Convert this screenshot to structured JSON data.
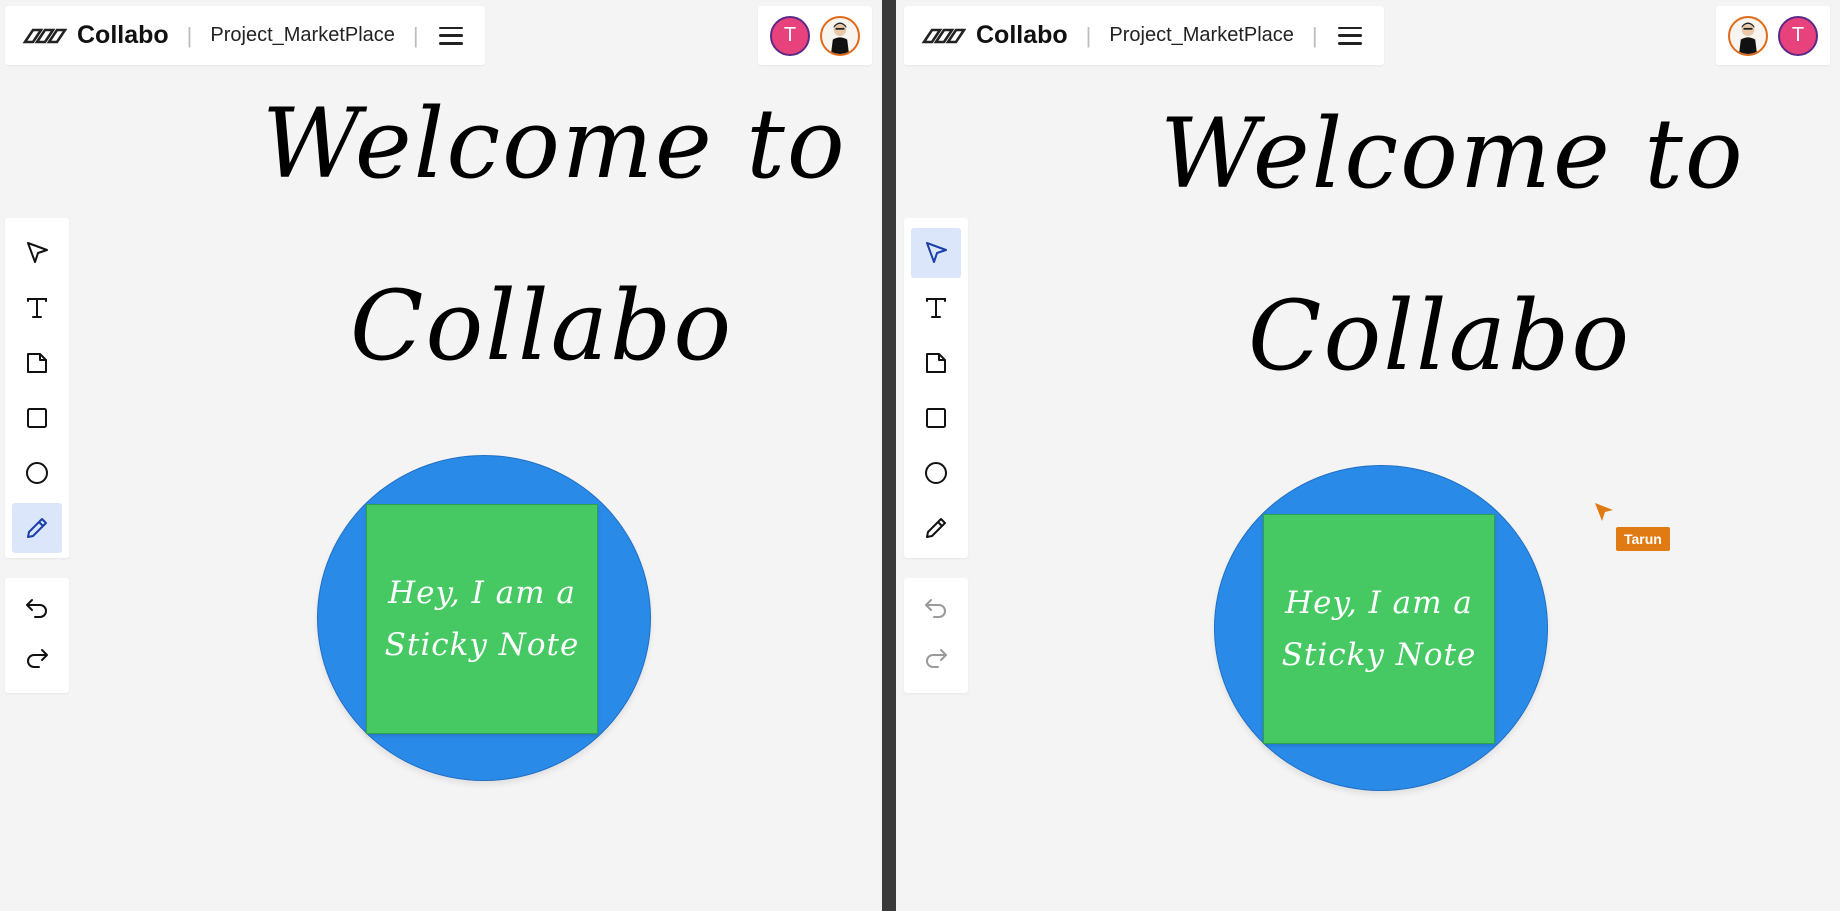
{
  "app": {
    "name": "Collabo",
    "project": "Project_MarketPlace"
  },
  "left_pane": {
    "avatars": [
      {
        "initial": "T",
        "color": "#e8427c"
      },
      {
        "kind": "photo-avatar"
      }
    ],
    "active_tool": "pencil",
    "canvas": {
      "welcome_line1": "Welcome to",
      "welcome_line2": "Collabo",
      "sticky_note_line1": "Hey, I am a",
      "sticky_note_line2": "Sticky Note"
    }
  },
  "right_pane": {
    "avatars": [
      {
        "kind": "photo-avatar"
      },
      {
        "initial": "T",
        "color": "#e8427c"
      }
    ],
    "active_tool": "select",
    "canvas": {
      "welcome_line1": "Welcome to",
      "welcome_line2": "Collabo",
      "sticky_note_line1": "Hey, I am a",
      "sticky_note_line2": "Sticky Note"
    },
    "remote_cursor": {
      "user": "Tarun",
      "color": "#e07a12"
    }
  },
  "tools": [
    "select",
    "text",
    "sticky-note",
    "rectangle",
    "ellipse",
    "pencil"
  ],
  "colors": {
    "canvas_bg": "#f4f4f4",
    "circle": "#2a8ae8",
    "sticky_note": "#46c963",
    "active_tool_bg": "#dbe6fb",
    "avatar_t": "#e8427c"
  }
}
